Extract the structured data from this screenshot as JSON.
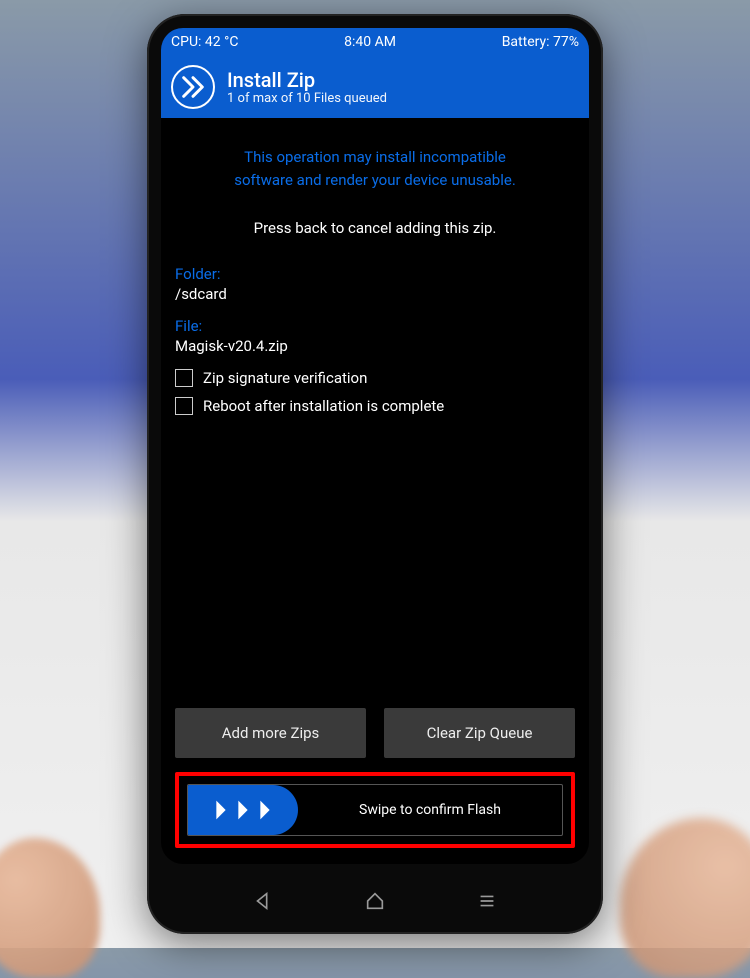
{
  "status": {
    "cpu": "CPU: 42 °C",
    "time": "8:40 AM",
    "battery": "Battery: 77%"
  },
  "header": {
    "title": "Install Zip",
    "subtitle": "1 of max of 10 Files queued"
  },
  "warning": {
    "line1": "This operation may install incompatible",
    "line2": "software and render your device unusable."
  },
  "instruction": "Press back to cancel adding this zip.",
  "folder": {
    "label": "Folder:",
    "value": "/sdcard"
  },
  "file": {
    "label": "File:",
    "value": "Magisk-v20.4.zip"
  },
  "options": {
    "zip_verify": "Zip signature verification",
    "reboot_after": "Reboot after installation is complete"
  },
  "buttons": {
    "add_more": "Add more Zips",
    "clear_queue": "Clear Zip Queue"
  },
  "swipe": {
    "label": "Swipe to confirm Flash"
  }
}
